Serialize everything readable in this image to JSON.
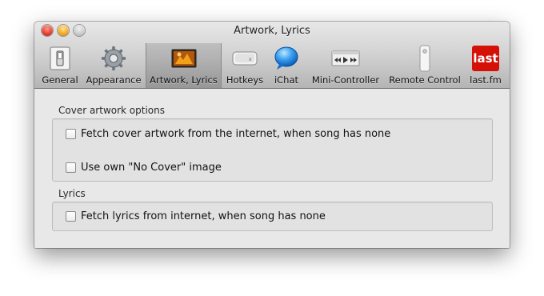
{
  "window": {
    "title": "Artwork, Lyrics"
  },
  "toolbar": {
    "items": [
      {
        "label": "General",
        "icon": "switch-icon",
        "selected": false
      },
      {
        "label": "Appearance",
        "icon": "gear-icon",
        "selected": false
      },
      {
        "label": "Artwork, Lyrics",
        "icon": "artwork-icon",
        "selected": true
      },
      {
        "label": "Hotkeys",
        "icon": "keyboard-key-icon",
        "selected": false
      },
      {
        "label": "iChat",
        "icon": "ichat-bubble-icon",
        "selected": false
      },
      {
        "label": "Mini-Controller",
        "icon": "mini-controller-icon",
        "selected": false
      },
      {
        "label": "Remote Control",
        "icon": "remote-control-icon",
        "selected": false
      },
      {
        "label": "last.fm",
        "icon": "lastfm-icon",
        "selected": false
      }
    ]
  },
  "cover": {
    "section_label": "Cover artwork options",
    "options": [
      {
        "label": "Fetch cover artwork from the internet, when song has none",
        "checked": false
      },
      {
        "label": "Use own \"No Cover\" image",
        "checked": false
      }
    ]
  },
  "lyrics": {
    "section_label": "Lyrics",
    "options": [
      {
        "label": "Fetch lyrics from internet, when song has none",
        "checked": false
      }
    ]
  },
  "lastfm_logo_text": "last",
  "colors": {
    "lastfm_red": "#d51007",
    "selected_tab_bg": "#9a9a9a"
  }
}
